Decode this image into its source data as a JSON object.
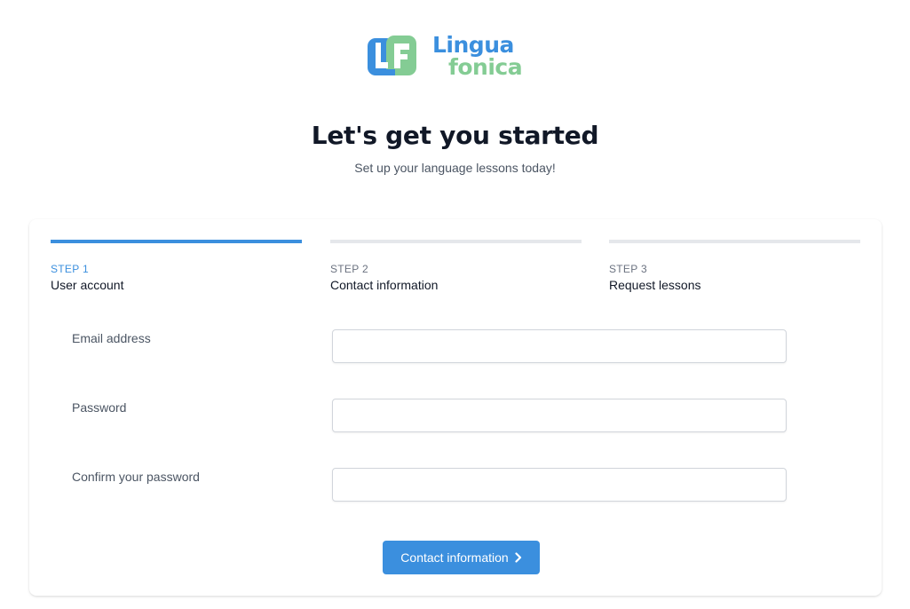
{
  "brand": {
    "logo_line1": "Lingua",
    "logo_line2": "fonica",
    "color_blue": "#3b8fde",
    "color_green": "#84cc94"
  },
  "header": {
    "title": "Let's get you started",
    "subtitle": "Set up your language lessons today!"
  },
  "steps": [
    {
      "number": "STEP 1",
      "label": "User account",
      "active": true
    },
    {
      "number": "STEP 2",
      "label": "Contact information",
      "active": false
    },
    {
      "number": "STEP 3",
      "label": "Request lessons",
      "active": false
    }
  ],
  "form": {
    "fields": [
      {
        "label": "Email address",
        "value": "",
        "placeholder": ""
      },
      {
        "label": "Password",
        "value": "",
        "placeholder": ""
      },
      {
        "label": "Confirm your password",
        "value": "",
        "placeholder": ""
      }
    ],
    "submit_label": "Contact information",
    "submit_icon": "chevron-right-icon"
  },
  "colors": {
    "accent": "#3b8fde",
    "inactive_step": "#e5e7eb"
  }
}
